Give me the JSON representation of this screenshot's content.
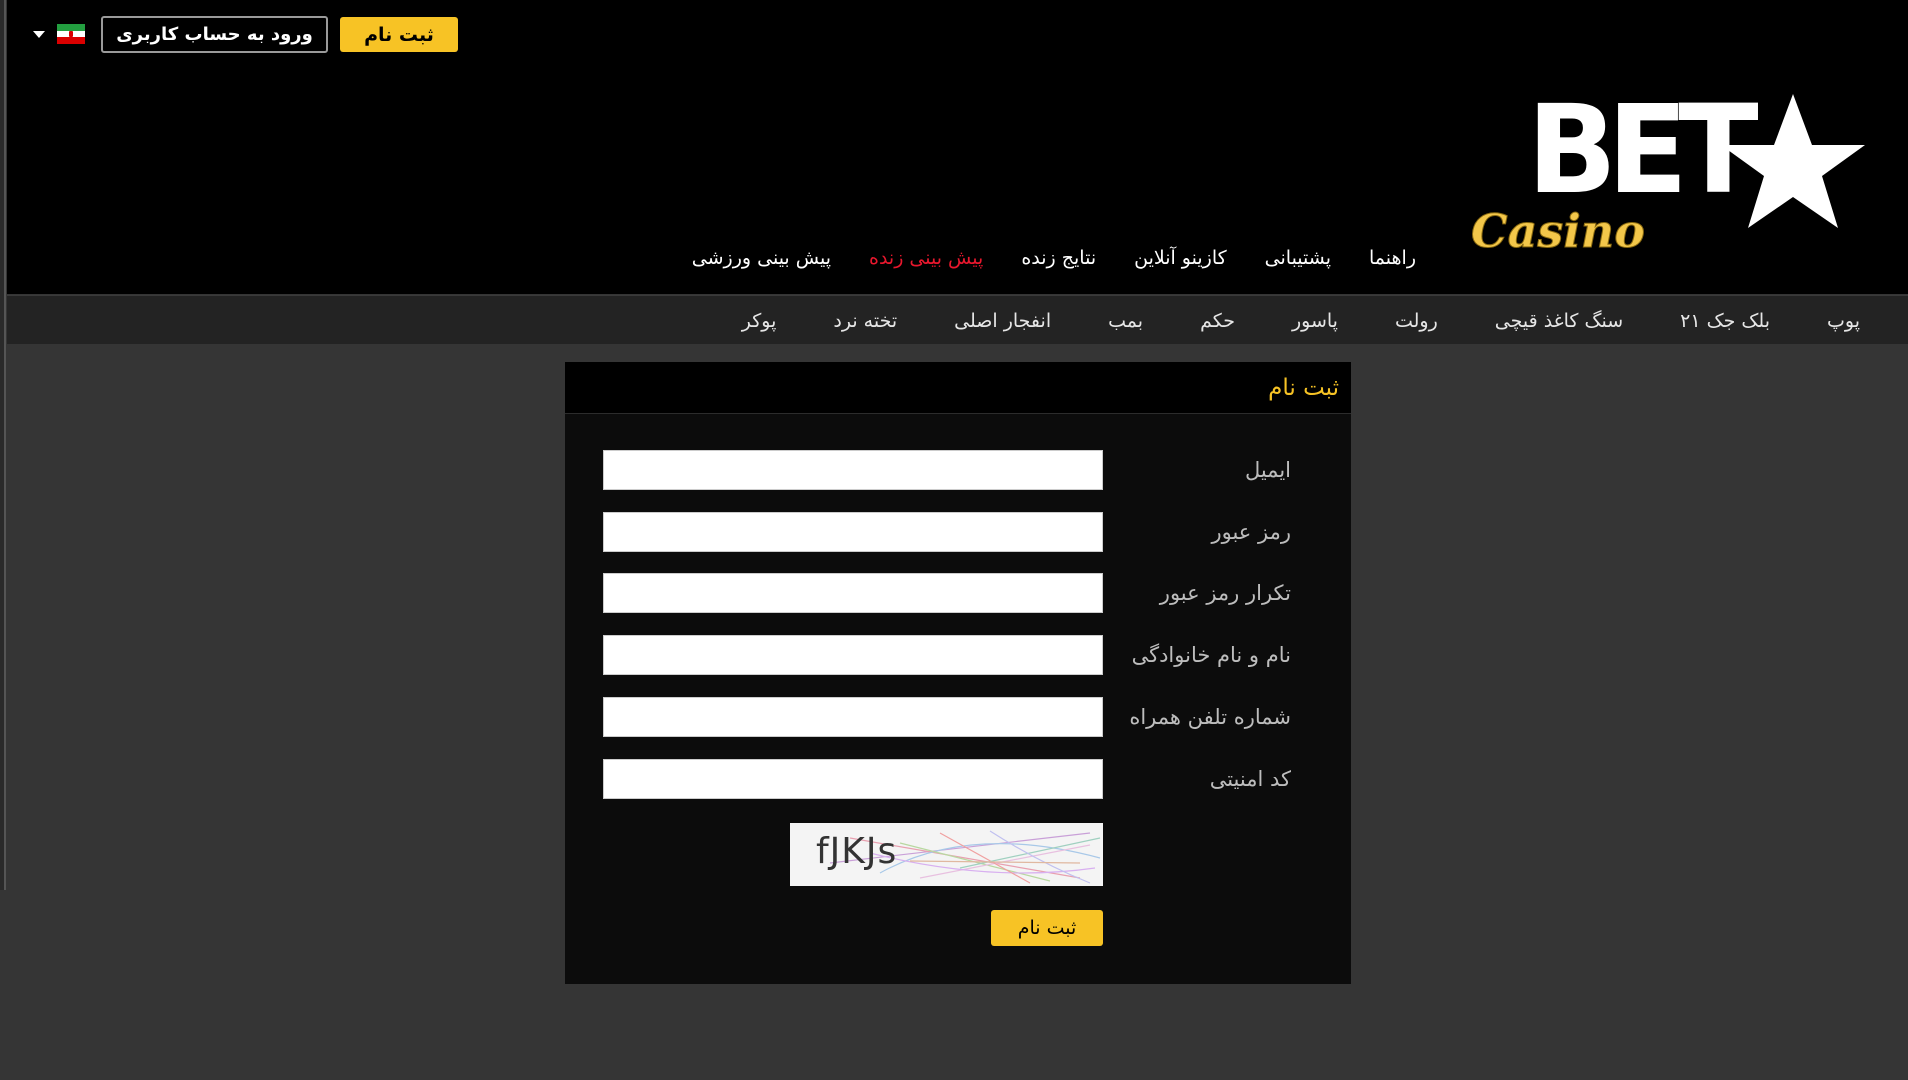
{
  "header": {
    "signup_label": "ثبت نام",
    "login_label": "ورود به حساب کاربری",
    "language": "fa"
  },
  "logo": {
    "bet_text": "BET",
    "casino_text": "Casino",
    "gold_color": "#f3c74a"
  },
  "main_nav": {
    "items": [
      {
        "label": "پیش بینی ورزشی",
        "active": false
      },
      {
        "label": "پیش بینی زنده",
        "active": true
      },
      {
        "label": "نتایج زنده",
        "active": false
      },
      {
        "label": "کازینو آنلاین",
        "active": false
      },
      {
        "label": "پشتیبانی",
        "active": false
      },
      {
        "label": "راهنما",
        "active": false
      }
    ],
    "active_color": "#e8172d"
  },
  "sub_nav": {
    "items": [
      {
        "label": "پوکر"
      },
      {
        "label": "تخته نرد"
      },
      {
        "label": "انفجار اصلی"
      },
      {
        "label": "بمب"
      },
      {
        "label": "حکم"
      },
      {
        "label": "پاسور"
      },
      {
        "label": "رولت"
      },
      {
        "label": "سنگ کاغذ قیچی"
      },
      {
        "label": "بلک جک ۲۱"
      },
      {
        "label": "پوپ"
      }
    ]
  },
  "form": {
    "title": "ثبت نام",
    "fields": [
      {
        "label": "ایمیل",
        "value": ""
      },
      {
        "label": "رمز عبور",
        "value": ""
      },
      {
        "label": "تکرار رمز عبور",
        "value": ""
      },
      {
        "label": "نام و نام خانوادگی",
        "value": ""
      },
      {
        "label": "شماره تلفن همراه",
        "value": ""
      },
      {
        "label": "کد امنیتی",
        "value": ""
      }
    ],
    "captcha_text": "fJKJs",
    "submit_label": "ثبت نام"
  },
  "colors": {
    "accent": "#f7c325",
    "page_bg": "#353535",
    "header_bg": "#000000",
    "panel_bg": "#0c0c0c"
  }
}
